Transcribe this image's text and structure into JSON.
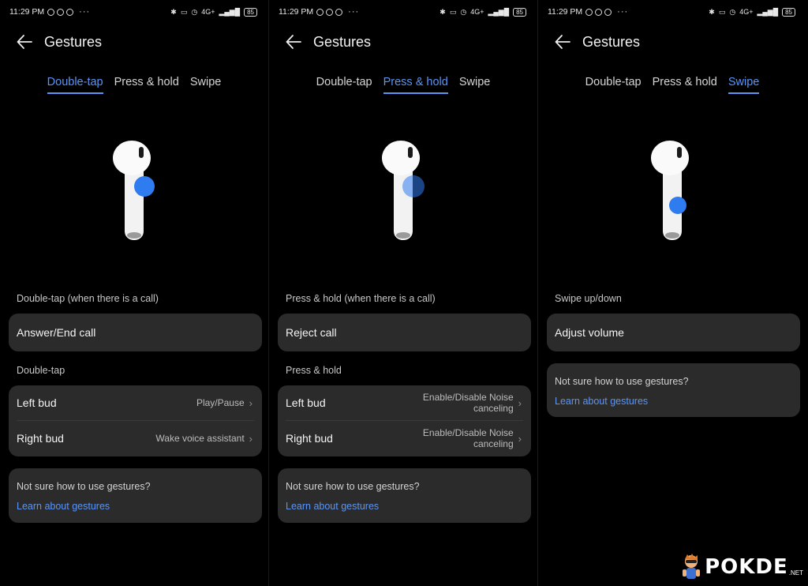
{
  "status_bar": {
    "time": "11:29 PM",
    "network": "4G+",
    "battery": "85"
  },
  "header": {
    "title": "Gestures"
  },
  "tabs": [
    "Double-tap",
    "Press & hold",
    "Swipe"
  ],
  "panels": [
    {
      "active_tab": "Double-tap",
      "call_section": {
        "label": "Double-tap (when there is a call)",
        "value": "Answer/End call"
      },
      "bud_section": {
        "label": "Double-tap",
        "left_label": "Left bud",
        "left_value": "Play/Pause",
        "right_label": "Right bud",
        "right_value": "Wake voice assistant"
      },
      "help": {
        "question": "Not sure how to use gestures?",
        "link": "Learn about gestures"
      }
    },
    {
      "active_tab": "Press & hold",
      "call_section": {
        "label": "Press & hold (when there is a call)",
        "value": "Reject call"
      },
      "bud_section": {
        "label": "Press & hold",
        "left_label": "Left bud",
        "left_value": "Enable/Disable Noise canceling",
        "right_label": "Right bud",
        "right_value": "Enable/Disable Noise canceling"
      },
      "help": {
        "question": "Not sure how to use gestures?",
        "link": "Learn about gestures"
      }
    },
    {
      "active_tab": "Swipe",
      "call_section": {
        "label": "Swipe up/down",
        "value": "Adjust volume"
      },
      "help": {
        "question": "Not sure how to use gestures?",
        "link": "Learn about gestures"
      }
    }
  ],
  "watermark": {
    "text": "POKDE",
    "suffix": ".NET"
  },
  "colors": {
    "accent": "#5b95f5",
    "card": "#2b2b2b",
    "background": "#000000",
    "tap_indicator": "#2f7bf0"
  }
}
